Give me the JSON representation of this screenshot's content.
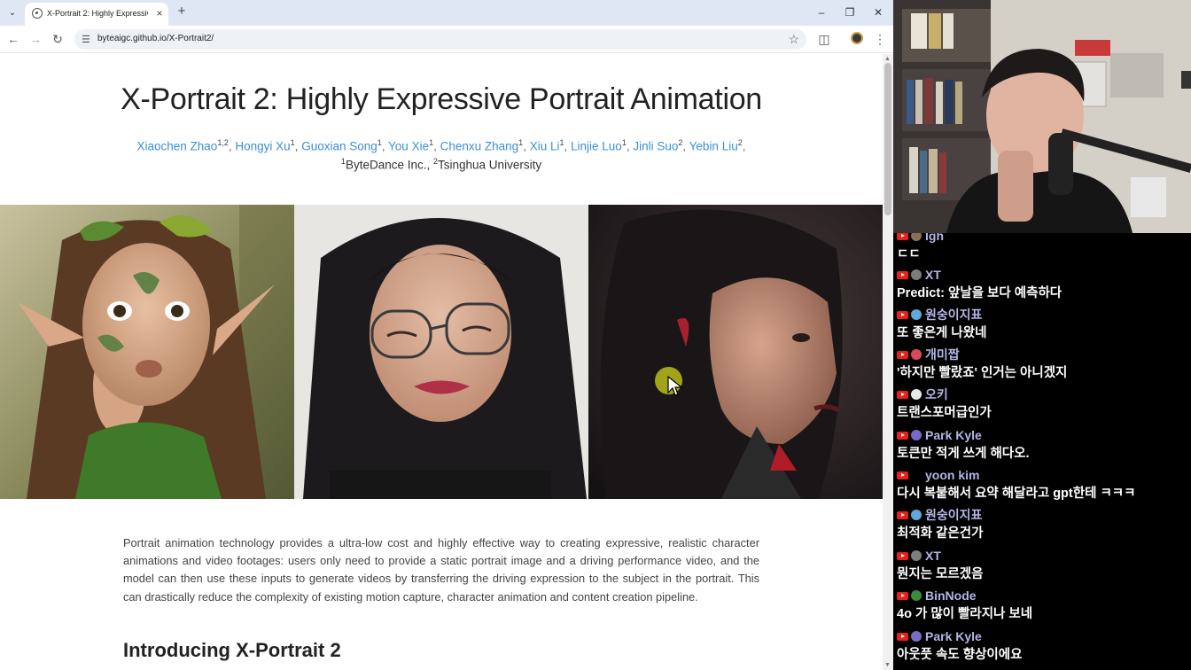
{
  "browser": {
    "tab_title": "X-Portrait 2: Highly Expressive",
    "url": "byteaigc.github.io/X-Portrait2/"
  },
  "page": {
    "title": "X-Portrait 2: Highly Expressive Portrait Animation",
    "authors": [
      {
        "name": "Xiaochen Zhao",
        "sup": "1,2"
      },
      {
        "name": "Hongyi Xu",
        "sup": "1"
      },
      {
        "name": "Guoxian Song",
        "sup": "1"
      },
      {
        "name": "You Xie",
        "sup": "1"
      },
      {
        "name": "Chenxu Zhang",
        "sup": "1"
      },
      {
        "name": "Xiu Li",
        "sup": "1"
      },
      {
        "name": "Linjie Luo",
        "sup": "1"
      },
      {
        "name": "Jinli Suo",
        "sup": "2"
      },
      {
        "name": "Yebin Liu",
        "sup": "2"
      }
    ],
    "affiliations": [
      {
        "sup": "1",
        "name": "ByteDance Inc."
      },
      {
        "sup": "2",
        "name": "Tsinghua University"
      }
    ],
    "abstract": "Portrait animation technology provides a ultra-low cost and highly effective way to creating expressive, realistic character animations and video footages: users only need to provide a static portrait image and a driving performance video, and the model can then use these inputs to generate videos by transferring the driving expression to the subject in the portrait. This can drastically reduce the complexity of existing motion capture, character animation and content creation pipeline.",
    "section_title": "Introducing X-Portrait 2"
  },
  "chat": [
    {
      "name": "lgh",
      "text": "ㄷㄷ",
      "avatar_color": "#8a6e5a",
      "name_color": "#b5b5e8"
    },
    {
      "name": "XT",
      "text": "Predict: 앞날을 보다 예측하다",
      "avatar_color": "#7d7d7d",
      "name_color": "#b5b5e8"
    },
    {
      "name": "원숭이지표",
      "text": "또 좋은게 나왔네",
      "avatar_color": "#5fa8d8",
      "name_color": "#b5b5e8"
    },
    {
      "name": "개미짭",
      "text": "'하지만 빨랐죠' 인거는 아니겠지",
      "avatar_color": "#d84a5a",
      "name_color": "#b5b5e8"
    },
    {
      "name": "오키",
      "text": "트랜스포머급인가",
      "avatar_color": "#e8e8e8",
      "name_color": "#b5b5e8"
    },
    {
      "name": "Park Kyle",
      "text": "토큰만 적게 쓰게 해다오.",
      "avatar_color": "#7a6ac8",
      "name_color": "#b5b5e8"
    },
    {
      "name": "yoon kim",
      "text": "다시 복붙해서 요약 해달라고 gpt한테 ㅋㅋㅋ",
      "avatar_color": "#000000",
      "name_color": "#b5b5e8"
    },
    {
      "name": "원숭이지표",
      "text": "최적화 같은건가",
      "avatar_color": "#5fa8d8",
      "name_color": "#b5b5e8"
    },
    {
      "name": "XT",
      "text": "뭔지는 모르겠음",
      "avatar_color": "#7d7d7d",
      "name_color": "#b5b5e8"
    },
    {
      "name": "BinNode",
      "text": "4o 가 많이 빨라지나 보네",
      "avatar_color": "#3c8a3c",
      "name_color": "#b5b5e8"
    },
    {
      "name": "Park Kyle",
      "text": "아웃풋 속도 향상이에요",
      "avatar_color": "#7a6ac8",
      "name_color": "#b5b5e8"
    }
  ],
  "colors": {
    "link": "#3a8fd6",
    "tabstrip": "#dfe7f5",
    "youtube_red": "#e62117"
  }
}
